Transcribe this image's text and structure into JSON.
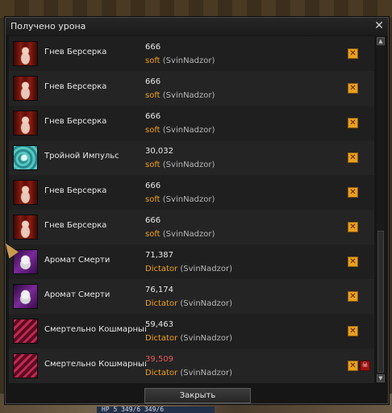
{
  "window": {
    "title": "Получено урона",
    "close_glyph": "✕",
    "close_button_label": "Закрыть"
  },
  "hud": {
    "hp_text": "HP  5 349/6 349/6"
  },
  "rows": [
    {
      "icon": "berserker-rage-icon",
      "skill": "Гнев Берсерка",
      "damage": "666",
      "damage_color": "#e8e8e8",
      "attacker": "soft",
      "server": "(SvinNadzor)",
      "statuses": [
        "shield-broken-icon"
      ]
    },
    {
      "icon": "berserker-rage-icon",
      "skill": "Гнев Берсерка",
      "damage": "666",
      "damage_color": "#e8e8e8",
      "attacker": "soft",
      "server": "(SvinNadzor)",
      "statuses": [
        "shield-broken-icon"
      ]
    },
    {
      "icon": "berserker-rage-icon",
      "skill": "Гнев Берсерка",
      "damage": "666",
      "damage_color": "#e8e8e8",
      "attacker": "soft",
      "server": "(SvinNadzor)",
      "statuses": [
        "shield-broken-icon"
      ]
    },
    {
      "icon": "triple-impulse-icon",
      "skill": "Тройной Импульс",
      "damage": "30,032",
      "damage_color": "#e8e8e8",
      "attacker": "soft",
      "server": "(SvinNadzor)",
      "statuses": [
        "shield-broken-icon"
      ]
    },
    {
      "icon": "berserker-rage-icon",
      "skill": "Гнев Берсерка",
      "damage": "666",
      "damage_color": "#e8e8e8",
      "attacker": "soft",
      "server": "(SvinNadzor)",
      "statuses": [
        "shield-broken-icon"
      ]
    },
    {
      "icon": "berserker-rage-icon",
      "skill": "Гнев Берсерка",
      "damage": "666",
      "damage_color": "#e8e8e8",
      "attacker": "soft",
      "server": "(SvinNadzor)",
      "statuses": [
        "shield-broken-icon"
      ]
    },
    {
      "icon": "death-aroma-icon",
      "skill": "Аромат Смерти",
      "damage": "71,387",
      "damage_color": "#e8e8e8",
      "attacker": "Dictator",
      "server": "(SvinNadzor)",
      "statuses": [
        "shield-broken-icon"
      ]
    },
    {
      "icon": "death-aroma-icon",
      "skill": "Аромат Смерти",
      "damage": "76,174",
      "damage_color": "#e8e8e8",
      "attacker": "Dictator",
      "server": "(SvinNadzor)",
      "statuses": [
        "shield-broken-icon"
      ]
    },
    {
      "icon": "deadly-nightmare-icon",
      "skill": "Смертельно Кошмарный Ц",
      "damage": "59,463",
      "damage_color": "#e8e8e8",
      "attacker": "Dictator",
      "server": "(SvinNadzor)",
      "statuses": [
        "shield-broken-icon"
      ]
    },
    {
      "icon": "deadly-nightmare-icon",
      "skill": "Смертельно Кошмарный Ц",
      "damage": "39,509",
      "damage_color": "#e55a5a",
      "attacker": "Dictator",
      "server": "(SvinNadzor)",
      "statuses": [
        "shield-broken-icon",
        "skull-icon"
      ]
    }
  ],
  "colors": {
    "attacker_name": "#f0a020",
    "server_name": "#b8b8b8",
    "critical_damage": "#e55a5a"
  }
}
